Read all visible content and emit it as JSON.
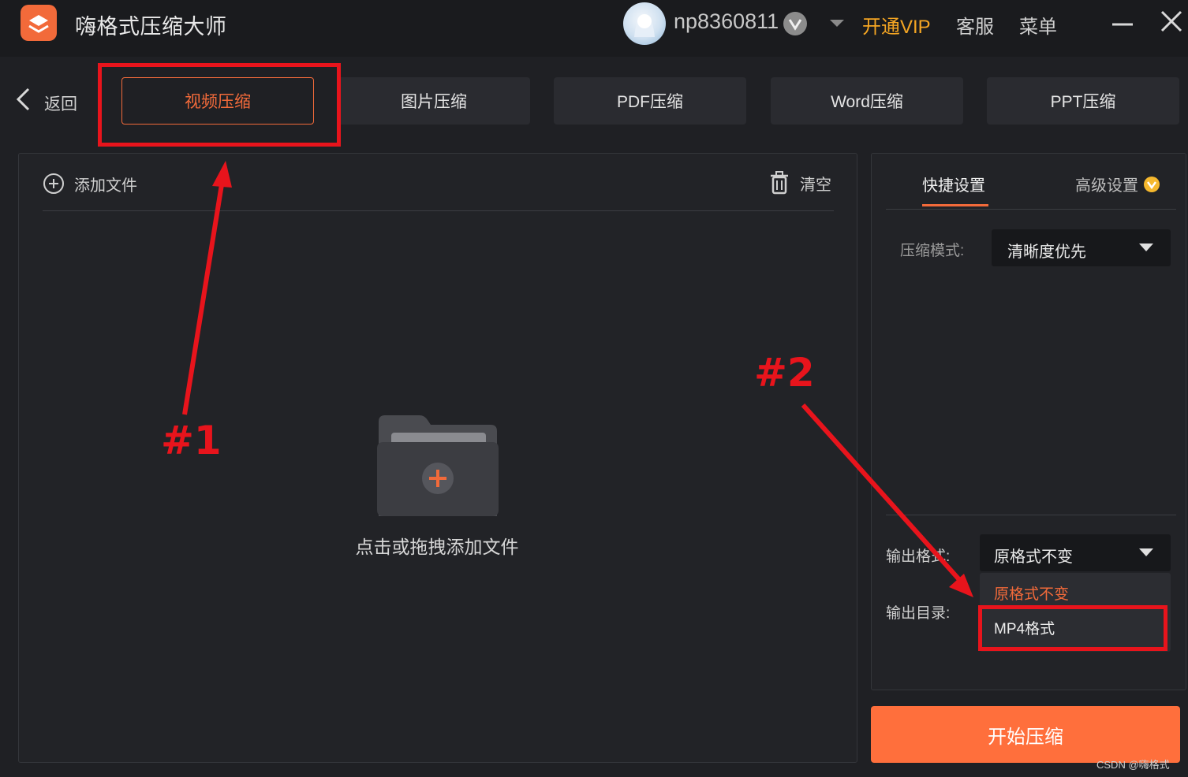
{
  "titlebar": {
    "app_title": "嗨格式压缩大师",
    "username": "np8360811",
    "vip_label": "开通VIP",
    "service_label": "客服",
    "menu_label": "菜单"
  },
  "nav": {
    "back_label": "返回",
    "tabs": [
      {
        "label": "视频压缩",
        "active": true
      },
      {
        "label": "图片压缩",
        "active": false
      },
      {
        "label": "PDF压缩",
        "active": false
      },
      {
        "label": "Word压缩",
        "active": false
      },
      {
        "label": "PPT压缩",
        "active": false
      }
    ]
  },
  "file_panel": {
    "add_files_label": "添加文件",
    "clear_label": "清空",
    "drop_hint": "点击或拖拽添加文件"
  },
  "settings": {
    "quick_tab": "快捷设置",
    "advanced_tab": "高级设置",
    "mode_label": "压缩模式:",
    "mode_value": "清晰度优先",
    "format_label": "输出格式:",
    "format_value": "原格式不变",
    "dir_label": "输出目录:",
    "format_options": [
      "原格式不变",
      "MP4格式"
    ]
  },
  "start_button": "开始压缩",
  "annotations": {
    "label1": "#1",
    "label2": "#2"
  },
  "watermark": "CSDN @嗨格式",
  "colors": {
    "accent": "#f26a3a",
    "start_button": "#ff6f3c",
    "vip": "#f5a623",
    "annotation": "#e8141c",
    "background": "#1f2024"
  },
  "icons": [
    "app-logo-icon",
    "avatar",
    "silver-badge-icon",
    "chevron-down-icon",
    "minimize-icon",
    "close-icon",
    "back-arrow-icon",
    "plus-circle-icon",
    "trash-icon",
    "crown-icon",
    "folder-add-icon"
  ]
}
